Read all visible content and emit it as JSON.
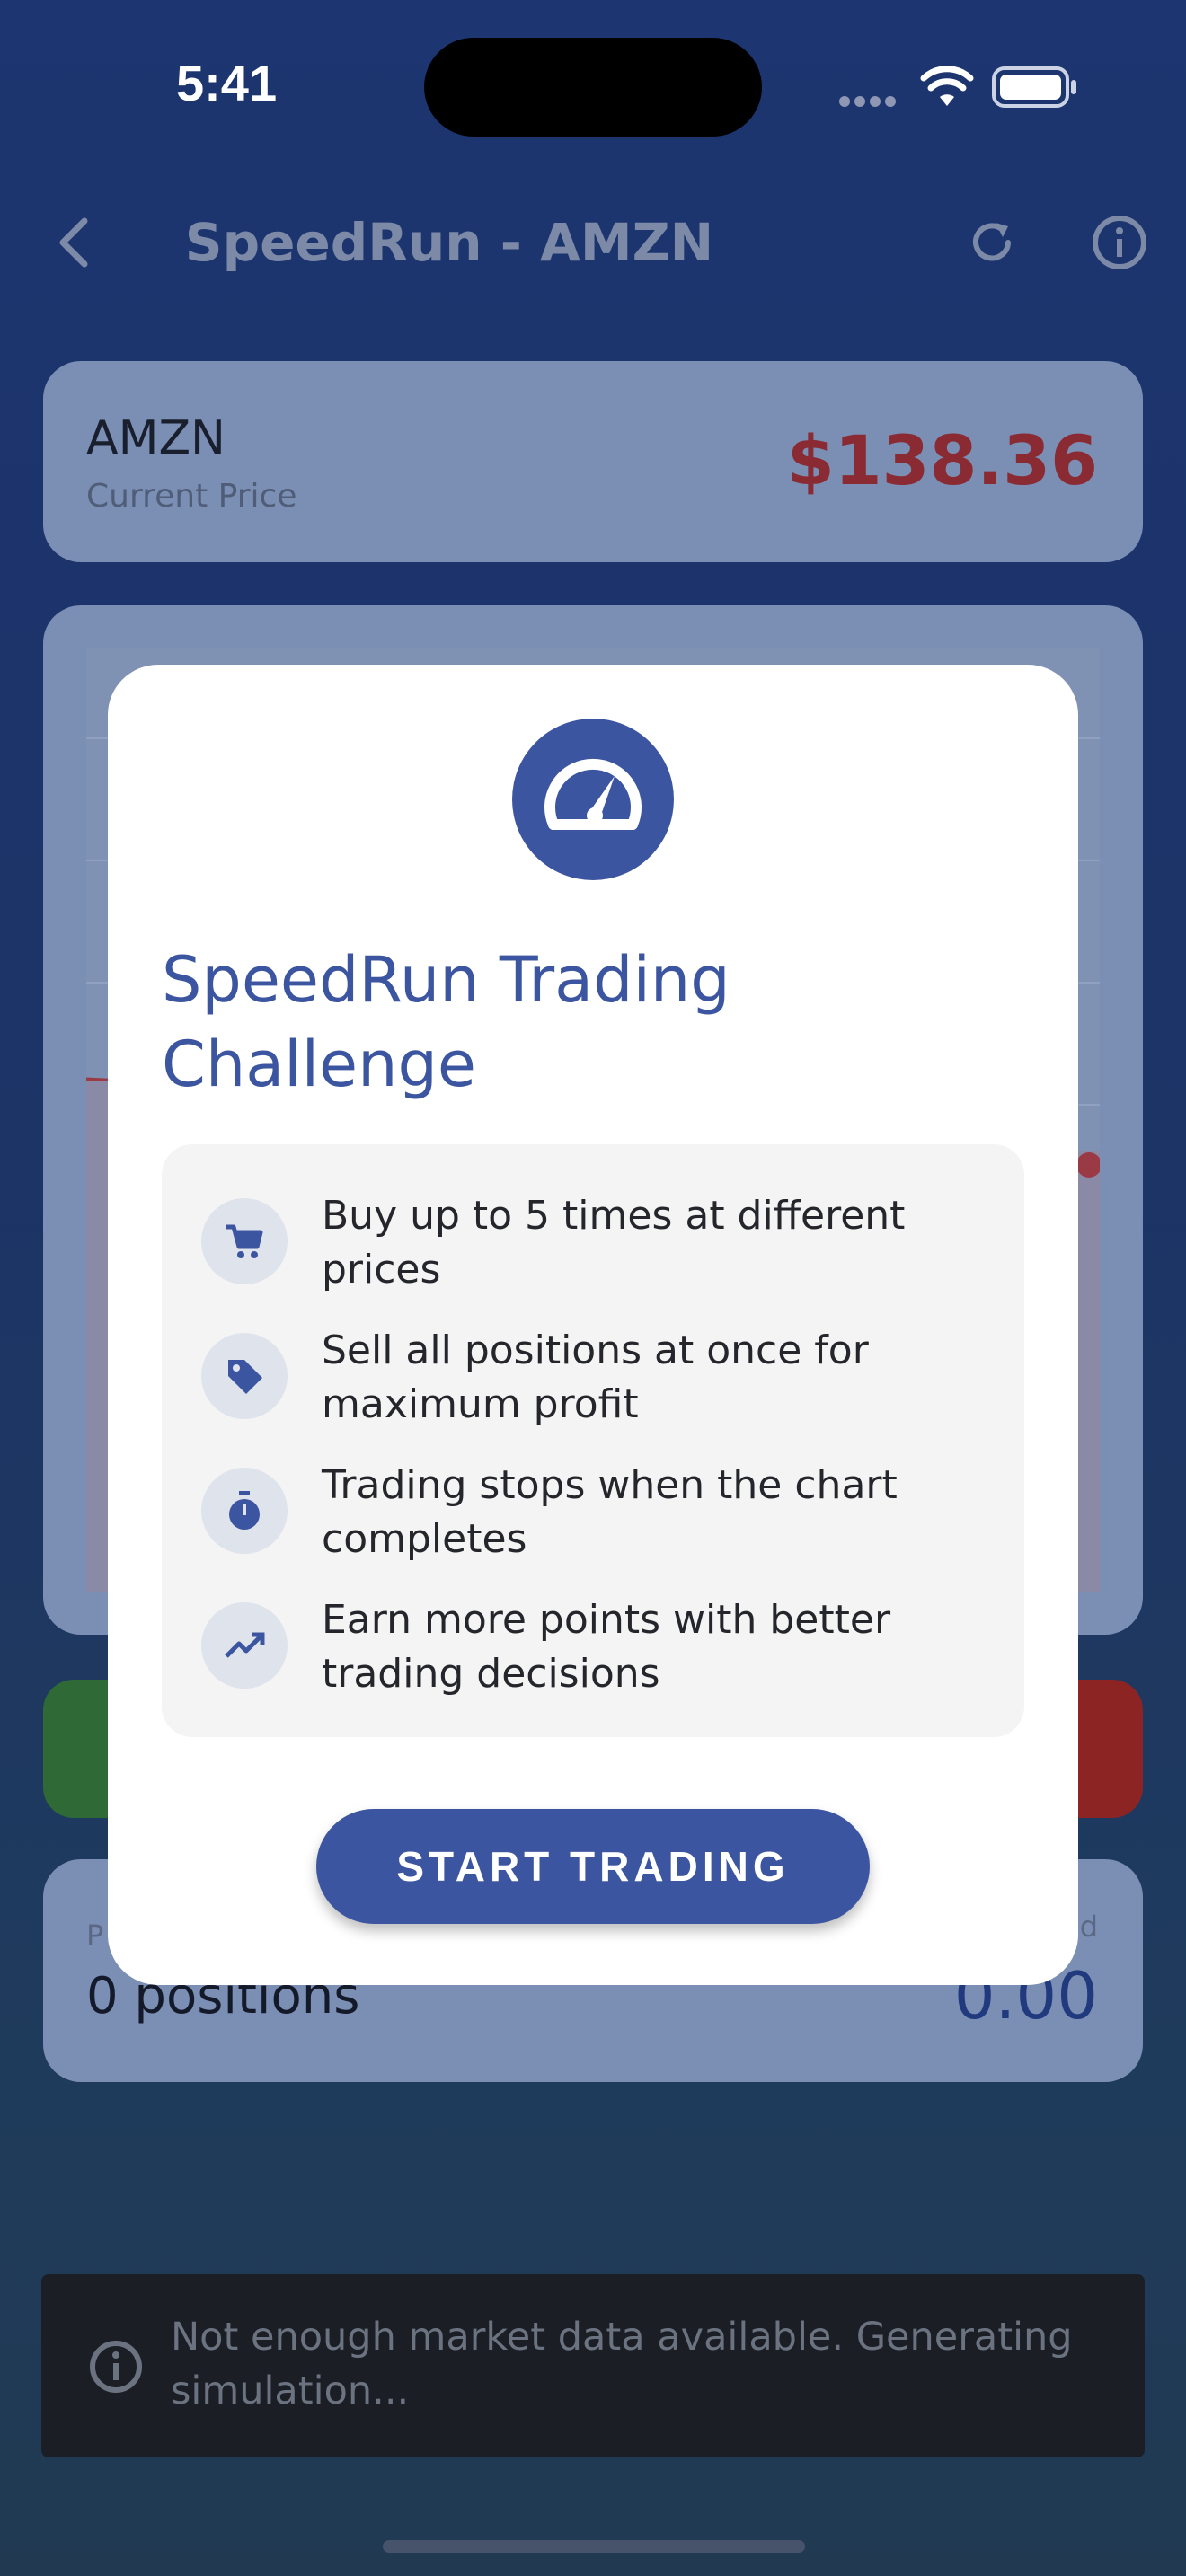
{
  "status_bar": {
    "time": "5:41"
  },
  "app_bar": {
    "title": "SpeedRun - AMZN"
  },
  "price_card": {
    "ticker": "AMZN",
    "subtitle": "Current Price",
    "price": "$138.36"
  },
  "positions_card": {
    "left_label": "P",
    "positions": "0 positions",
    "right_label": "d",
    "value": "0.00"
  },
  "dialog": {
    "title": "SpeedRun Trading Challenge",
    "features": [
      {
        "icon": "cart-icon",
        "text": "Buy up to 5 times at different prices"
      },
      {
        "icon": "tag-icon",
        "text": "Sell all positions at once for maximum profit"
      },
      {
        "icon": "stopwatch-icon",
        "text": "Trading stops when the chart completes"
      },
      {
        "icon": "trending-up-icon",
        "text": "Earn more points with better trading decisions"
      }
    ],
    "button": "START TRADING"
  },
  "snackbar": {
    "message": "Not enough market data available. Generating simulation..."
  },
  "colors": {
    "primary": "#3c55a0",
    "price_red": "#c62828",
    "buy_green": "#43a047",
    "sell_red": "#e53935"
  }
}
